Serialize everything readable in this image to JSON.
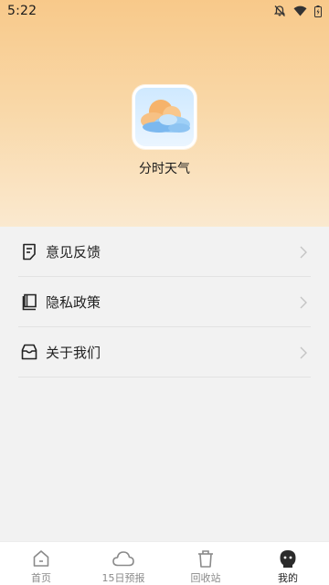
{
  "status_bar": {
    "time": "5:22"
  },
  "app": {
    "name": "分时天气"
  },
  "menu": [
    {
      "label": "意见反馈",
      "icon": "feedback-icon"
    },
    {
      "label": "隐私政策",
      "icon": "book-icon"
    },
    {
      "label": "关于我们",
      "icon": "inbox-icon"
    }
  ],
  "tabbar": [
    {
      "label": "首页",
      "icon": "home-icon",
      "active": false
    },
    {
      "label": "15日预报",
      "icon": "cloud-icon",
      "active": false
    },
    {
      "label": "回收站",
      "icon": "trash-icon",
      "active": false
    },
    {
      "label": "我的",
      "icon": "profile-icon",
      "active": true
    }
  ],
  "colors": {
    "header_gradient_top": "#f8c98a",
    "header_gradient_bottom": "#fae9cf",
    "background": "#f2f2f2",
    "tab_active": "#222222",
    "tab_inactive": "#8a8a8a"
  }
}
